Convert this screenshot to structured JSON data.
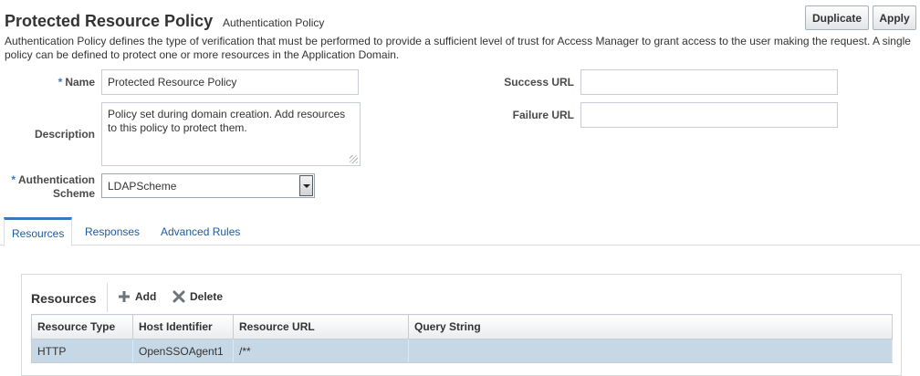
{
  "header": {
    "title": "Protected Resource Policy",
    "subtitle": "Authentication Policy",
    "duplicate_label": "Duplicate",
    "apply_label": "Apply",
    "description": "Authentication Policy defines the type of verification that must be performed to provide a sufficient level of trust for Access Manager to grant access to the user making the request. A single policy can be defined to protect one or more resources in the Application Domain."
  },
  "form": {
    "required_marker": "*",
    "name_label": "Name",
    "name_value": "Protected Resource Policy",
    "description_label": "Description",
    "description_value": "Policy set during domain creation. Add resources to this policy to protect them.",
    "auth_scheme_label_line1": "Authentication",
    "auth_scheme_label_line2": "Scheme",
    "auth_scheme_value": "LDAPScheme",
    "success_url_label": "Success URL",
    "success_url_value": "",
    "failure_url_label": "Failure URL",
    "failure_url_value": ""
  },
  "tabs": [
    {
      "label": "Resources",
      "active": true
    },
    {
      "label": "Responses",
      "active": false
    },
    {
      "label": "Advanced Rules",
      "active": false
    }
  ],
  "resources_panel": {
    "title": "Resources",
    "add_label": "Add",
    "delete_label": "Delete",
    "columns": [
      "Resource Type",
      "Host Identifier",
      "Resource URL",
      "Query String"
    ],
    "rows": [
      [
        "HTTP",
        "OpenSSOAgent1",
        "/**",
        ""
      ]
    ]
  },
  "colors": {
    "accent": "#3a78b8",
    "selected_row": "#c6d7e6",
    "link": "#1e5a99"
  }
}
